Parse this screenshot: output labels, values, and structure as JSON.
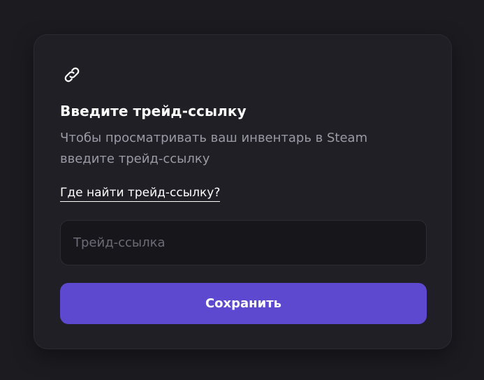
{
  "card": {
    "icon": "link-icon",
    "title": "Введите трейд-ссылку",
    "subtitle": "Чтобы просматривать ваш инвентарь в Steam введите трейд-ссылку",
    "help_link": "Где найти трейд-ссылку?",
    "input": {
      "value": "",
      "placeholder": "Трейд-ссылка"
    },
    "save_label": "Сохранить"
  },
  "colors": {
    "background": "#1b1b20",
    "card": "#1f1f25",
    "accent": "#5d48d0",
    "muted_text": "#9b9aa5",
    "placeholder": "#6c6b77"
  }
}
